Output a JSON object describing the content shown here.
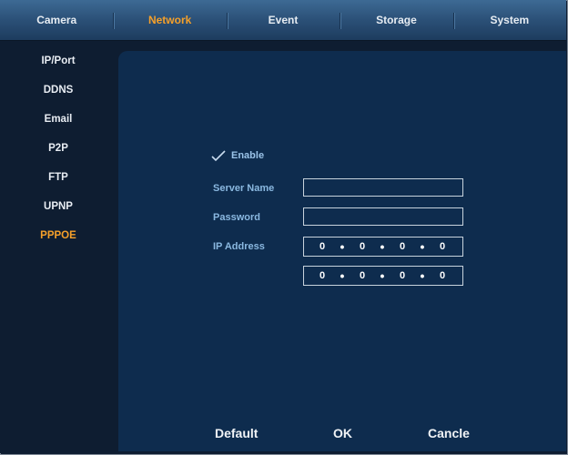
{
  "tabs": [
    {
      "label": "Camera"
    },
    {
      "label": "Network"
    },
    {
      "label": "Event"
    },
    {
      "label": "Storage"
    },
    {
      "label": "System"
    }
  ],
  "active_tab": "Network",
  "sidebar": {
    "items": [
      {
        "label": "IP/Port"
      },
      {
        "label": "DDNS"
      },
      {
        "label": "Email"
      },
      {
        "label": "P2P"
      },
      {
        "label": "FTP"
      },
      {
        "label": "UPNP"
      },
      {
        "label": "PPPOE"
      }
    ],
    "active": "PPPOE"
  },
  "form": {
    "enable_label": "Enable",
    "enable_checked": true,
    "server_name_label": "Server Name",
    "server_name_value": "",
    "password_label": "Password",
    "password_value": "",
    "ip_label": "IP Address",
    "ip1": [
      "0",
      "0",
      "0",
      "0"
    ],
    "ip2": [
      "0",
      "0",
      "0",
      "0"
    ]
  },
  "footer": {
    "default_label": "Default",
    "ok_label": "OK",
    "cancel_label": "Cancle"
  },
  "colors": {
    "accent": "#f5a02a",
    "label": "#8ab8e0",
    "panel": "#0e2c4e",
    "topbar": "#2b5077"
  },
  "icons": {
    "enable_check": "check-icon"
  }
}
